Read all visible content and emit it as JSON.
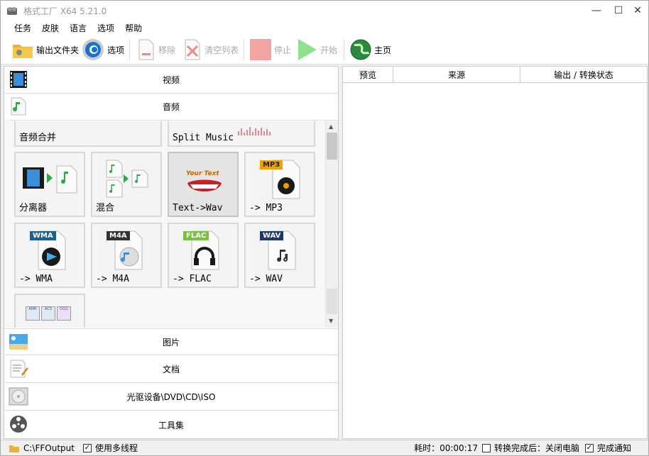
{
  "window": {
    "title": "格式工厂 X64 5.21.0"
  },
  "menu": [
    "任务",
    "皮肤",
    "语言",
    "选项",
    "帮助"
  ],
  "toolbar": {
    "output_folder": "输出文件夹",
    "options": "选项",
    "remove": "移除",
    "clear_list": "清空列表",
    "stop": "停止",
    "start": "开始",
    "home": "主页"
  },
  "categories": {
    "video": "视频",
    "audio": "音频",
    "image": "图片",
    "document": "文档",
    "optical": "光驱设备\\DVD\\CD\\ISO",
    "tools": "工具集"
  },
  "tiles": [
    {
      "label": "音频合并"
    },
    {
      "label": "Split Music"
    },
    {
      "label": "分离器"
    },
    {
      "label": "混合"
    },
    {
      "label": "Text->Wav",
      "badge": "Your Text"
    },
    {
      "label": "-> MP3",
      "badge": "MP3"
    },
    {
      "label": "-> WMA",
      "badge": "WMA"
    },
    {
      "label": "-> M4A",
      "badge": "M4A"
    },
    {
      "label": "-> FLAC",
      "badge": "FLAC"
    },
    {
      "label": "-> WAV",
      "badge": "WAV"
    },
    {
      "label": "",
      "mini_badges": [
        "AMR",
        "AC3",
        "OGG"
      ]
    }
  ],
  "table": {
    "columns": [
      "预览",
      "来源",
      "输出 / 转换状态"
    ]
  },
  "status": {
    "path": "C:\\FFOutput",
    "multithread": "使用多线程",
    "elapsed": "耗时：00:00:17",
    "after_convert": "转换完成后：关闭电脑",
    "notify": "完成通知",
    "multithread_checked": true,
    "after_convert_checked": false,
    "notify_checked": true
  },
  "colors": {
    "mp3": "#f0a000",
    "wma": "#1f5f8f",
    "m4a": "#333333",
    "flac": "#7ac143",
    "wav": "#1f3a66",
    "start": "#6dd36d",
    "stop": "#f4a3a3"
  }
}
